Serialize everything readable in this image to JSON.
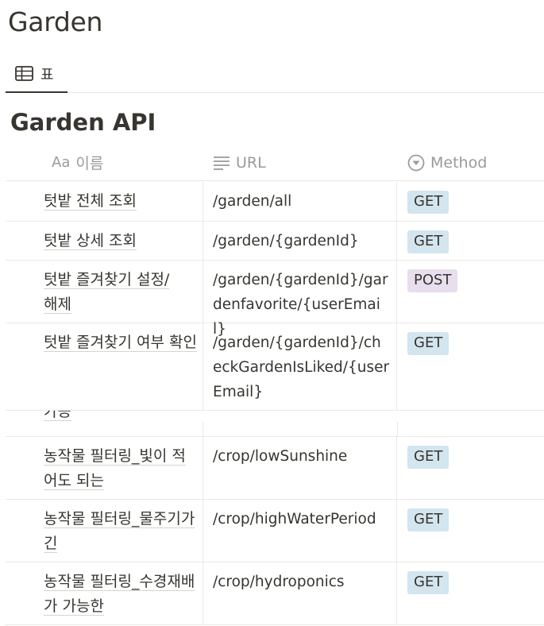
{
  "page": {
    "title": "Garden"
  },
  "view_tab": {
    "icon": "table-icon",
    "label": "표"
  },
  "database": {
    "title": "Garden API"
  },
  "columns": {
    "name": {
      "icon": "text-aa-icon",
      "icon_text": "Aa",
      "label": "이름"
    },
    "url": {
      "icon": "lines-icon",
      "label": "URL"
    },
    "method": {
      "icon": "select-circle-icon",
      "label": "Method"
    }
  },
  "rows": [
    {
      "name": "텃밭 전체 조회",
      "url": "/garden/all",
      "method": "GET"
    },
    {
      "name": "텃밭 상세 조회",
      "url": "/garden/{gardenId}",
      "method": "GET"
    },
    {
      "name": "텃밭 즐겨찾기 설정/해제",
      "url": "/garden/{gardenId}/gardenfavorite/{userEmail}",
      "method": "POST"
    },
    {
      "name": "텃밭 즐겨찾기 여부 확인",
      "url": "/garden/{gardenId}/checkGardenIsLiked/{userEmail}",
      "method": "GET"
    }
  ],
  "clipped_row": {
    "name_fragment": "가능"
  },
  "rows_after": [
    {
      "name": "농작물 필터링_빛이 적어도 되는",
      "url": "/crop/lowSunshine",
      "method": "GET"
    },
    {
      "name": "농작물 필터링_물주기가 긴",
      "url": "/crop/highWaterPeriod",
      "method": "GET"
    },
    {
      "name": "농작물 필터링_수경재배가 가능한",
      "url": "/crop/hydroponics",
      "method": "GET"
    }
  ],
  "colors": {
    "get_badge": "#d3e5ef",
    "post_badge": "#e8deee",
    "text": "#37352f",
    "muted": "#9b9a97"
  }
}
